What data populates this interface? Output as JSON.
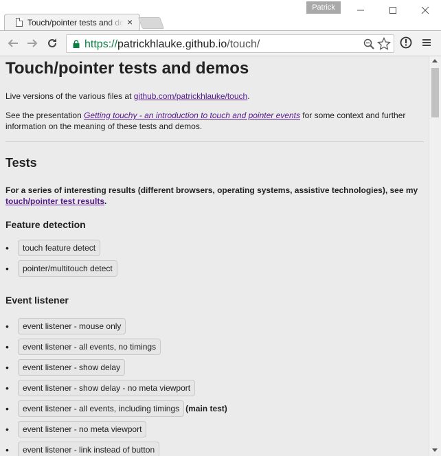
{
  "window": {
    "user_name": "Patrick",
    "tab_title": "Touch/pointer tests and demos",
    "tab_close": "×"
  },
  "toolbar": {
    "url_scheme": "https://",
    "url_host": "patrickhlauke.github.io",
    "url_path": "/touch/"
  },
  "page": {
    "title": "Touch/pointer tests and demos",
    "intro_text": "Live versions of the various files at ",
    "intro_link": "github.com/patrickhlauke/touch",
    "intro_end": ".",
    "presentation_text": "See the presentation ",
    "presentation_link": "Getting touchy - an introduction to touch and pointer events",
    "presentation_end": " for some context and further information on the meaning of these tests and demos.",
    "tests_heading": "Tests",
    "results_text": "For a series of interesting results (different browsers, operating systems, assistive technologies), see my ",
    "results_link": "touch/pointer test results",
    "results_end": ".",
    "feature_heading": "Feature detection",
    "feature_items": [
      "touch feature detect",
      "pointer/multitouch detect"
    ],
    "event_heading": "Event listener",
    "event_items": [
      "event listener - mouse only",
      "event listener - all events, no timings",
      "event listener - show delay",
      "event listener - show delay - no meta viewport",
      "event listener - all events, including timings",
      "event listener - no meta viewport",
      "event listener - link instead of button"
    ],
    "main_test_note": "(main test)"
  }
}
